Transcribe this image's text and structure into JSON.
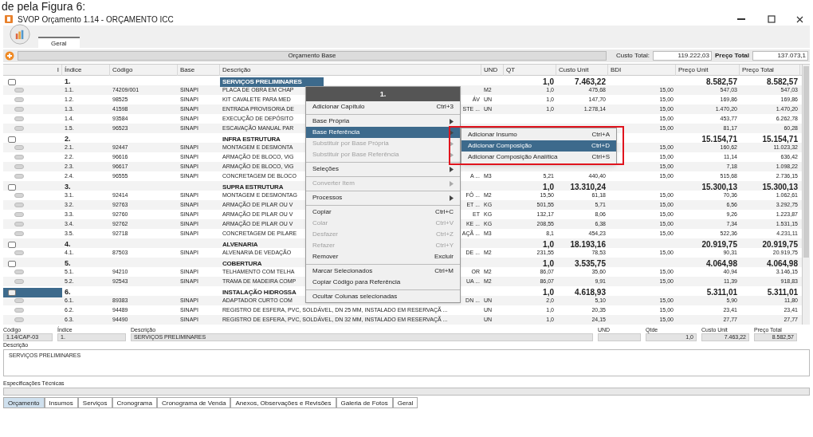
{
  "caption": "de pela Figura 6:",
  "window": {
    "title": "SVOP Orçamento 1.14 - ORÇAMENTO ICC"
  },
  "ribbon": {
    "tabs": [
      {
        "label": "Geral",
        "selected": true
      }
    ]
  },
  "toolbar": {
    "title": "Orçamento Base",
    "cost_label": "Custo Total:",
    "cost_value": "119.222,03",
    "price_label": "Preço Total",
    "price_value": "137.073,1"
  },
  "table": {
    "columns": [
      "I",
      "Índice",
      "Código",
      "Base",
      "Descrição",
      "UND",
      "QT",
      "Custo Unit",
      "BDI",
      "Preço Unit",
      "Preço Total"
    ],
    "rows": [
      {
        "kind": "group",
        "index": "1.",
        "description": "SERVIÇOS PRELIMINARES",
        "qt": "1,0",
        "unit_cost": "7.463,22",
        "unit_price": "8.582,57",
        "total_price": "8.582,57",
        "selected": true,
        "cursor": false
      },
      {
        "kind": "item",
        "index": "1.1.",
        "code": "74209/001",
        "base": "SINAPI",
        "description": "PLACA DE OBRA EM CHAP",
        "und": "M2",
        "qt": "1,0",
        "unit_cost": "475,68",
        "bdi": "15,00",
        "unit_price": "547,03",
        "total_price": "547,03",
        "selected": false,
        "cursor": false
      },
      {
        "kind": "item",
        "index": "1.2.",
        "code": "98525",
        "base": "SINAPI",
        "description": "KIT CAVALETE PARA MED",
        "description_tail": "ÁV",
        "und": "UN",
        "qt": "1,0",
        "unit_cost": "147,70",
        "bdi": "15,00",
        "unit_price": "169,86",
        "total_price": "169,86",
        "selected": false,
        "cursor": false
      },
      {
        "kind": "item",
        "index": "1.3.",
        "code": "41598",
        "base": "SINAPI",
        "description": "ENTRADA PROVISORIA DE",
        "description_tail": "STE ...",
        "und": "UN",
        "qt": "1,0",
        "unit_cost": "1.278,14",
        "bdi": "15,00",
        "unit_price": "1.470,20",
        "total_price": "1.470,20",
        "selected": false,
        "cursor": false
      },
      {
        "kind": "item",
        "index": "1.4.",
        "code": "93584",
        "base": "SINAPI",
        "description": "EXECUÇÃO DE DEPÓSITO",
        "bdi": "15,00",
        "unit_price": "453,77",
        "total_price": "6.262,78",
        "selected": false,
        "cursor": false
      },
      {
        "kind": "item",
        "index": "1.5.",
        "code": "96523",
        "base": "SINAPI",
        "description": "ESCAVAÇÃO MANUAL PAR",
        "bdi": "15,00",
        "unit_price": "81,17",
        "total_price": "60,28",
        "selected": false,
        "cursor": false
      },
      {
        "kind": "group",
        "index": "2.",
        "description": "INFRA ESTRUTURA",
        "unit_price": "15.154,71",
        "total_price": "15.154,71",
        "selected": false,
        "cursor": false
      },
      {
        "kind": "item",
        "index": "2.1.",
        "code": "92447",
        "base": "SINAPI",
        "description": "MONTAGEM E DESMONTA",
        "bdi": "15,00",
        "unit_price": "160,62",
        "total_price": "11.023,32",
        "selected": false,
        "cursor": false
      },
      {
        "kind": "item",
        "index": "2.2.",
        "code": "96616",
        "base": "SINAPI",
        "description": "ARMAÇÃO DE BLOCO, VIG",
        "bdi": "15,00",
        "unit_price": "11,14",
        "total_price": "636,42",
        "selected": false,
        "cursor": false
      },
      {
        "kind": "item",
        "index": "2.3.",
        "code": "96617",
        "base": "SINAPI",
        "description": "ARMAÇÃO DE BLOCO, VIG",
        "bdi": "15,00",
        "unit_price": "7,18",
        "total_price": "1.098,22",
        "selected": false,
        "cursor": false
      },
      {
        "kind": "item",
        "index": "2.4.",
        "code": "96555",
        "base": "SINAPI",
        "description": "CONCRETAGEM DE BLOCO",
        "description_tail": "A ...",
        "und": "M3",
        "qt": "5,21",
        "unit_cost": "440,40",
        "bdi": "15,00",
        "unit_price": "515,68",
        "total_price": "2.736,15",
        "selected": false,
        "cursor": false
      },
      {
        "kind": "group",
        "index": "3.",
        "description": "SUPRA ESTRUTURA",
        "qt": "1,0",
        "unit_cost": "13.310,24",
        "unit_price": "15.300,13",
        "total_price": "15.300,13",
        "selected": false,
        "cursor": false
      },
      {
        "kind": "item",
        "index": "3.1.",
        "code": "92414",
        "base": "SINAPI",
        "description": "MONTAGEM E DESMONTAG",
        "description_tail": "FÔ ...",
        "und": "M2",
        "qt": "15,50",
        "unit_cost": "61,18",
        "bdi": "15,00",
        "unit_price": "70,36",
        "total_price": "1.062,61",
        "selected": false,
        "cursor": false
      },
      {
        "kind": "item",
        "index": "3.2.",
        "code": "92763",
        "base": "SINAPI",
        "description": "ARMAÇÃO DE PILAR OU V",
        "description_tail": "ET ...",
        "und": "KG",
        "qt": "501,55",
        "unit_cost": "5,71",
        "bdi": "15,00",
        "unit_price": "6,56",
        "total_price": "3.292,75",
        "selected": false,
        "cursor": false
      },
      {
        "kind": "item",
        "index": "3.3.",
        "code": "92760",
        "base": "SINAPI",
        "description": "ARMAÇÃO DE PILAR OU V",
        "description_tail": "ET",
        "und": "KG",
        "qt": "132,17",
        "unit_cost": "8,06",
        "bdi": "15,00",
        "unit_price": "9,26",
        "total_price": "1.223,87",
        "selected": false,
        "cursor": false
      },
      {
        "kind": "item",
        "index": "3.4.",
        "code": "92762",
        "base": "SINAPI",
        "description": "ARMAÇÃO DE PILAR OU V",
        "description_tail": "KE ...",
        "und": "KG",
        "qt": "208,55",
        "unit_cost": "6,38",
        "bdi": "15,00",
        "unit_price": "7,34",
        "total_price": "1.531,15",
        "selected": false,
        "cursor": false
      },
      {
        "kind": "item",
        "index": "3.5.",
        "code": "92718",
        "base": "SINAPI",
        "description": "CONCRETAGEM DE PILARE",
        "description_tail": "AÇÃ ...",
        "und": "M3",
        "qt": "8,1",
        "unit_cost": "454,23",
        "bdi": "15,00",
        "unit_price": "522,36",
        "total_price": "4.231,11",
        "selected": false,
        "cursor": false
      },
      {
        "kind": "group",
        "index": "4.",
        "description": "ALVENARIA",
        "qt": "1,0",
        "unit_cost": "18.193,16",
        "unit_price": "20.919,75",
        "total_price": "20.919,75",
        "selected": false,
        "cursor": false
      },
      {
        "kind": "item",
        "index": "4.1.",
        "code": "87503",
        "base": "SINAPI",
        "description": "ALVENARIA DE VEDAÇÃO",
        "description_tail": "DE ...",
        "und": "M2",
        "qt": "231,55",
        "unit_cost": "78,53",
        "bdi": "15,00",
        "unit_price": "90,31",
        "total_price": "20.919,75",
        "selected": false,
        "cursor": false
      },
      {
        "kind": "group",
        "index": "5.",
        "description": "COBERTURA",
        "qt": "1,0",
        "unit_cost": "3.535,75",
        "unit_price": "4.064,98",
        "total_price": "4.064,98",
        "selected": false,
        "cursor": false
      },
      {
        "kind": "item",
        "index": "5.1.",
        "code": "94210",
        "base": "SINAPI",
        "description": "TELHAMENTO COM TELHA",
        "description_tail": "OR",
        "und": "M2",
        "qt": "86,07",
        "unit_cost": "35,60",
        "bdi": "15,00",
        "unit_price": "40,94",
        "total_price": "3.146,15",
        "selected": false,
        "cursor": false
      },
      {
        "kind": "item",
        "index": "5.2.",
        "code": "92543",
        "base": "SINAPI",
        "description": "TRAMA DE MADEIRA COMP",
        "description_tail": "UA ...",
        "und": "M2",
        "qt": "86,07",
        "unit_cost": "9,91",
        "bdi": "15,00",
        "unit_price": "11,39",
        "total_price": "918,83",
        "selected": false,
        "cursor": false
      },
      {
        "kind": "group",
        "index": "6.",
        "description": "INSTALAÇÃO HIDROSSA",
        "qt": "1,0",
        "unit_cost": "4.618,93",
        "unit_price": "5.311,01",
        "total_price": "5.311,01",
        "selected": false,
        "cursor": true
      },
      {
        "kind": "item",
        "index": "6.1.",
        "code": "89383",
        "base": "SINAPI",
        "description": "ADAPTADOR CURTO COM",
        "description_tail": "DN ...",
        "und": "UN",
        "qt": "2,0",
        "unit_cost": "5,10",
        "bdi": "15,00",
        "unit_price": "5,90",
        "total_price": "11,80",
        "selected": false,
        "cursor": false
      },
      {
        "kind": "item",
        "index": "6.2.",
        "code": "94489",
        "base": "SINAPI",
        "description": "REGISTRO DE ESFERA, PVC, SOLDÁVEL, DN 25 MM, INSTALADO EM RESERVAÇÃ ...",
        "und": "UN",
        "qt": "1,0",
        "unit_cost": "20,35",
        "bdi": "15,00",
        "unit_price": "23,41",
        "total_price": "23,41",
        "selected": false,
        "cursor": false
      },
      {
        "kind": "item",
        "index": "6.3.",
        "code": "94490",
        "base": "SINAPI",
        "description": "REGISTRO DE ESFERA, PVC, SOLDÁVEL, DN 32 MM, INSTALADO EM RESERVAÇÃ ...",
        "und": "UN",
        "qt": "1,0",
        "unit_cost": "24,15",
        "bdi": "15,00",
        "unit_price": "27,77",
        "total_price": "27,77",
        "selected": false,
        "cursor": false
      }
    ]
  },
  "context_menu": {
    "header": "1.",
    "items": [
      {
        "kind": "item",
        "label": "Adicionar Capítulo",
        "shortcut": "Ctrl+3",
        "disabled": false,
        "selected": false,
        "submenu": false
      },
      {
        "kind": "separator"
      },
      {
        "kind": "item",
        "label": "Base Própria",
        "disabled": false,
        "selected": false,
        "submenu": true
      },
      {
        "kind": "item",
        "label": "Base Referência",
        "disabled": false,
        "selected": true,
        "submenu": true
      },
      {
        "kind": "item",
        "label": "Substituir por Base Própria",
        "disabled": true,
        "selected": false,
        "submenu": true
      },
      {
        "kind": "item",
        "label": "Substituir por Base Referência",
        "disabled": true,
        "selected": false,
        "submenu": true
      },
      {
        "kind": "separator"
      },
      {
        "kind": "item",
        "label": "Seleções",
        "disabled": false,
        "selected": false,
        "submenu": true
      },
      {
        "kind": "separator"
      },
      {
        "kind": "item",
        "label": "Converter Item",
        "disabled": true,
        "selected": false,
        "submenu": true
      },
      {
        "kind": "separator"
      },
      {
        "kind": "item",
        "label": "Processos",
        "disabled": false,
        "selected": false,
        "submenu": true
      },
      {
        "kind": "separator"
      },
      {
        "kind": "item",
        "label": "Copiar",
        "shortcut": "Ctrl+C",
        "disabled": false,
        "selected": false,
        "submenu": false
      },
      {
        "kind": "item",
        "label": "Colar",
        "shortcut": "Ctrl+V",
        "disabled": true,
        "selected": false,
        "submenu": false
      },
      {
        "kind": "item",
        "label": "Desfazer",
        "shortcut": "Ctrl+Z",
        "disabled": true,
        "selected": false,
        "submenu": false
      },
      {
        "kind": "item",
        "label": "Refazer",
        "shortcut": "Ctrl+Y",
        "disabled": true,
        "selected": false,
        "submenu": false
      },
      {
        "kind": "item",
        "label": "Remover",
        "shortcut": "Excluir",
        "disabled": false,
        "selected": false,
        "submenu": false
      },
      {
        "kind": "separator"
      },
      {
        "kind": "item",
        "label": "Marcar Selecionados",
        "shortcut": "Ctrl+M",
        "disabled": false,
        "selected": false,
        "submenu": false
      },
      {
        "kind": "item",
        "label": "Copiar Código para Referência",
        "disabled": false,
        "selected": false,
        "submenu": false
      },
      {
        "kind": "separator"
      },
      {
        "kind": "item",
        "label": "Ocultar Colunas selecionadas",
        "disabled": false,
        "selected": false,
        "submenu": false
      }
    ],
    "submenu": [
      {
        "label": "Adicionar Insumo",
        "shortcut": "Ctrl+A",
        "selected": false
      },
      {
        "label": "Adicionar Composição",
        "shortcut": "Ctrl+D",
        "selected": true
      },
      {
        "label": "Adicionar Composição Analítica",
        "shortcut": "Ctrl+S",
        "selected": false
      }
    ]
  },
  "detail": {
    "fields": [
      {
        "label": "Código",
        "value": "1.14/CAP-03"
      },
      {
        "label": "Índice",
        "value": "1."
      },
      {
        "label": "Descrição",
        "value": "SERVIÇOS PRELIMINARES"
      },
      {
        "label": "UND"
      },
      {
        "label": "Qtde",
        "value": "1,0"
      },
      {
        "label": "Custo Unit",
        "value": "7.463,22"
      },
      {
        "label": "Preço Total",
        "value": "8.582,57"
      }
    ],
    "description_label": "Descrição",
    "description": "SERVIÇOS PRELIMINARES",
    "spec_label": "Especificações Técnicas"
  },
  "bottom_tabs": [
    {
      "label": "Orçamento",
      "selected": true
    },
    {
      "label": "Insumos",
      "selected": false
    },
    {
      "label": "Serviços",
      "selected": false
    },
    {
      "label": "Cronograma",
      "selected": false
    },
    {
      "label": "Cronograma de Venda",
      "selected": false
    },
    {
      "label": "Anexos, Observações e Revisões",
      "selected": false
    },
    {
      "label": "Galeria de Fotos",
      "selected": false
    },
    {
      "label": "Geral",
      "selected": false
    }
  ]
}
